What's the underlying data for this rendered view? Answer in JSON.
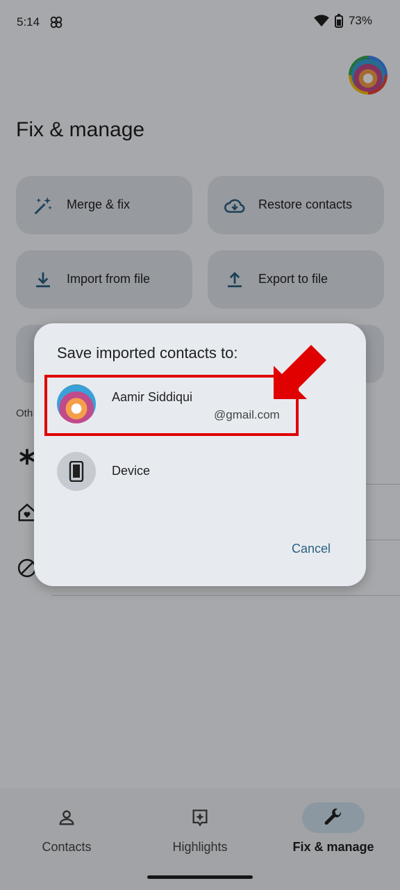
{
  "status_bar": {
    "time": "5:14",
    "battery": "73%"
  },
  "page": {
    "title": "Fix & manage",
    "cards": [
      {
        "label": "Merge & fix",
        "icon": "magic-wand-icon"
      },
      {
        "label": "Restore contacts",
        "icon": "cloud-download-icon"
      },
      {
        "label": "Import from file",
        "icon": "download-icon"
      },
      {
        "label": "Export to file",
        "icon": "upload-icon"
      }
    ],
    "other_label": "Oth"
  },
  "dialog": {
    "title": "Save imported contacts to:",
    "account": {
      "name": "Aamir Siddiqui",
      "email": "@gmail.com"
    },
    "device_label": "Device",
    "cancel_label": "Cancel"
  },
  "bottom_nav": {
    "items": [
      {
        "label": "Contacts",
        "icon": "person-icon",
        "active": false
      },
      {
        "label": "Highlights",
        "icon": "highlights-icon",
        "active": false
      },
      {
        "label": "Fix & manage",
        "icon": "wrench-icon",
        "active": true
      }
    ]
  },
  "colors": {
    "accent": "#2b6181",
    "annotation": "#e00000"
  }
}
